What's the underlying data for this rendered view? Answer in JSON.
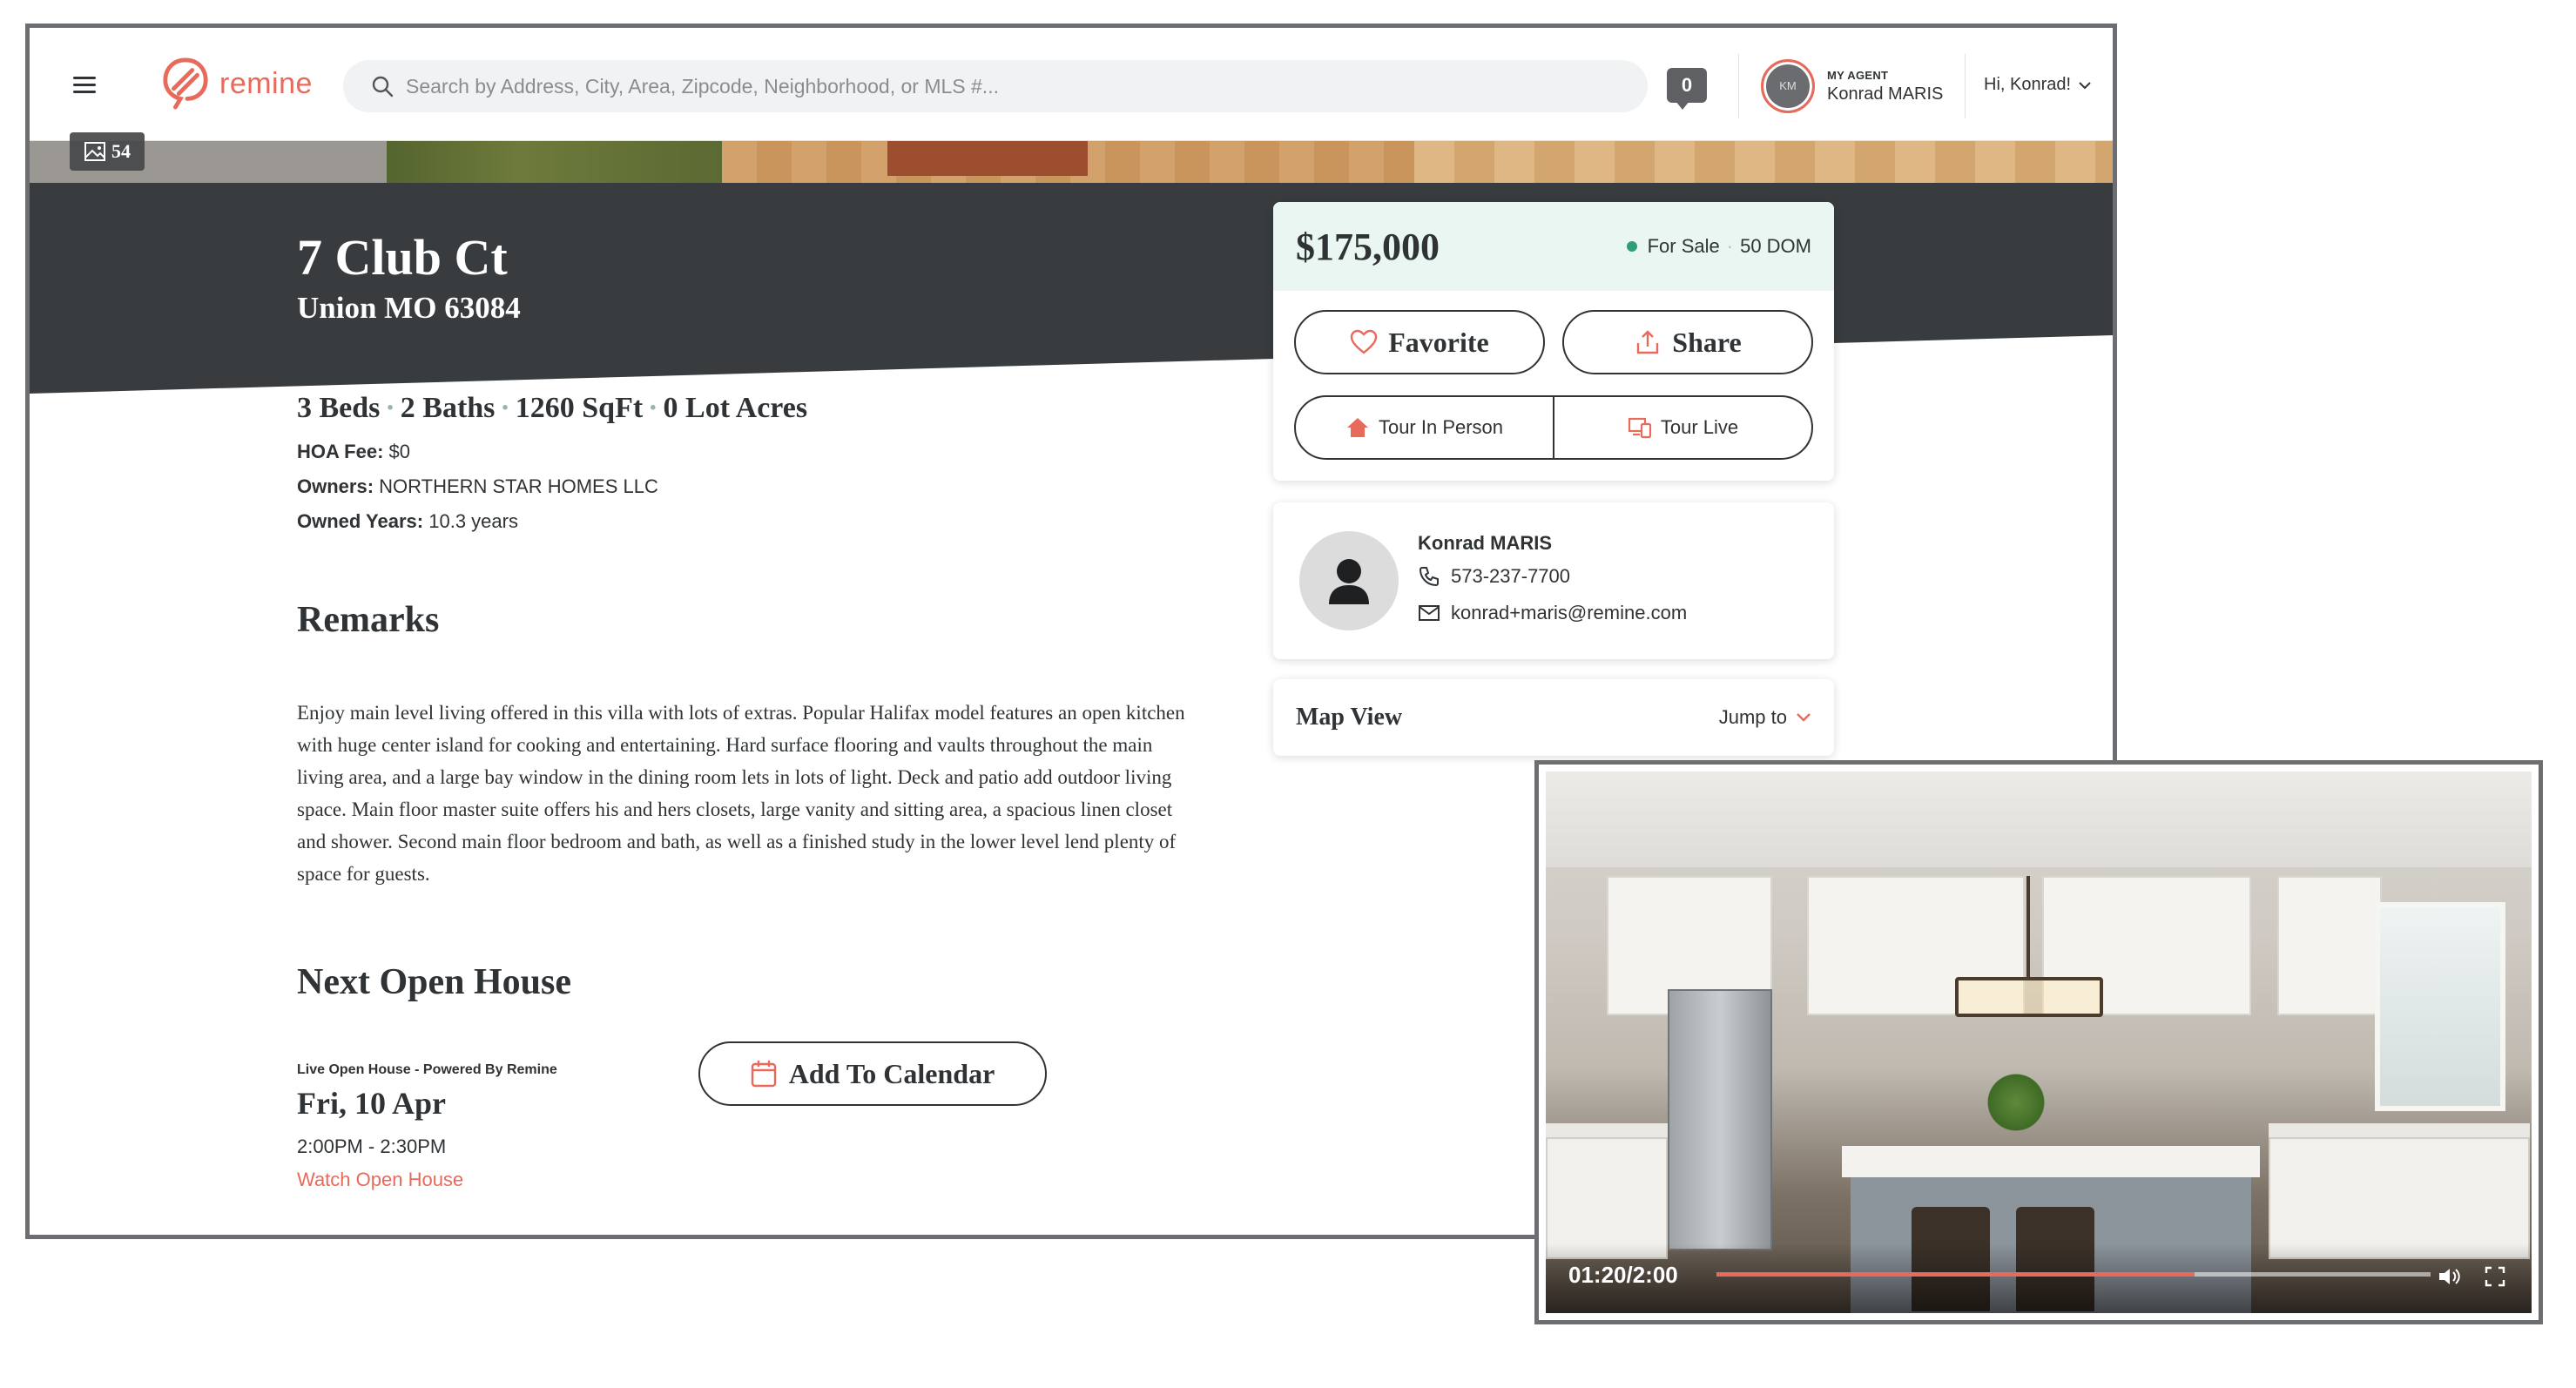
{
  "header": {
    "brand": "remine",
    "search_placeholder": "Search by Address, City, Area, Zipcode, Neighborhood, or MLS #...",
    "notification_count": "0",
    "agent_label": "MY AGENT",
    "agent_initials": "KM",
    "agent_name": "Konrad MARIS",
    "greeting": "Hi, Konrad!"
  },
  "gallery": {
    "photo_count": "54"
  },
  "listing": {
    "address_line1": "7 Club Ct",
    "address_line2": "Union MO 63084",
    "beds": "3 Beds",
    "baths": "2 Baths",
    "sqft": "1260 SqFt",
    "lot": "0 Lot Acres",
    "separator": "·",
    "hoa_label": "HOA Fee:",
    "hoa_value": "$0",
    "owners_label": "Owners:",
    "owners_value": "NORTHERN STAR HOMES LLC",
    "owned_label": "Owned Years:",
    "owned_value": "10.3 years"
  },
  "remarks": {
    "heading": "Remarks",
    "text": "Enjoy main level living offered in this villa with lots of extras. Popular Halifax model features an open kitchen with huge center island for cooking and entertaining. Hard surface flooring and vaults throughout the main living area, and a large bay window in the dining room lets in lots of light. Deck and patio add outdoor living space. Main floor master suite offers his and hers closets, large vanity and sitting area, a spacious linen closet and shower. Second main floor bedroom and bath, as well as a finished study in the lower level lend plenty of space for guests."
  },
  "open_house": {
    "heading": "Next Open House",
    "subtitle": "Live Open House - Powered By Remine",
    "date": "Fri, 10 Apr",
    "time": "2:00PM - 2:30PM",
    "watch_link": "Watch Open House",
    "calendar_button": "Add To Calendar"
  },
  "price_card": {
    "price": "$175,000",
    "status": "For Sale",
    "status_sep": "·",
    "dom": "50 DOM",
    "favorite": "Favorite",
    "share": "Share",
    "tour_in_person": "Tour In Person",
    "tour_live": "Tour Live",
    "status_color": "#2e9e74"
  },
  "agent_card": {
    "name": "Konrad MARIS",
    "phone": "573-237-7700",
    "email": "konrad+maris@remine.com"
  },
  "map_card": {
    "title": "Map View",
    "jump": "Jump to"
  },
  "video": {
    "time": "01:20/2:00",
    "progress": 0.67
  },
  "colors": {
    "accent": "#e86a5b",
    "dark_band": "#383c3e",
    "price_bg": "#eaf6f1",
    "text": "#2f3335"
  }
}
